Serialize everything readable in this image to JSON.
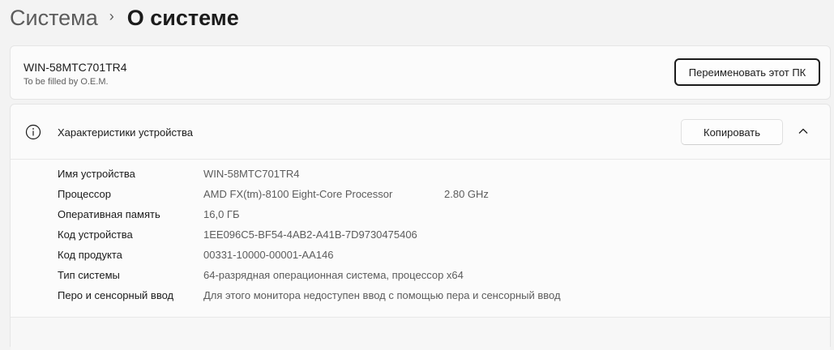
{
  "breadcrumb": {
    "parent": "Система",
    "separator": "›",
    "current": "О системе"
  },
  "pc_card": {
    "name": "WIN-58MTC701TR4",
    "subtitle": "To be filled by O.E.M.",
    "rename_button": "Переименовать этот ПК"
  },
  "device_specs": {
    "icon": "info-icon",
    "title": "Характеристики устройства",
    "copy_button": "Копировать",
    "collapse_icon": "chevron-up-icon",
    "rows": [
      {
        "label": "Имя устройства",
        "value": "WIN-58MTC701TR4",
        "extra": ""
      },
      {
        "label": "Процессор",
        "value": "AMD FX(tm)-8100 Eight-Core Processor",
        "extra": "2.80 GHz"
      },
      {
        "label": "Оперативная память",
        "value": "16,0 ГБ",
        "extra": ""
      },
      {
        "label": "Код устройства",
        "value": "1EE096C5-BF54-4AB2-A41B-7D9730475406",
        "extra": ""
      },
      {
        "label": "Код продукта",
        "value": "00331-10000-00001-AA146",
        "extra": ""
      },
      {
        "label": "Тип системы",
        "value": "64-разрядная операционная система, процессор x64",
        "extra": ""
      },
      {
        "label": "Перо и сенсорный ввод",
        "value": "Для этого монитора недоступен ввод с помощью пера и сенсорный ввод",
        "extra": ""
      }
    ]
  },
  "colors": {
    "background": "#f3f3f3",
    "card": "#fbfbfb",
    "text_primary": "#1b1b1b",
    "text_secondary": "#5c5c5c"
  }
}
